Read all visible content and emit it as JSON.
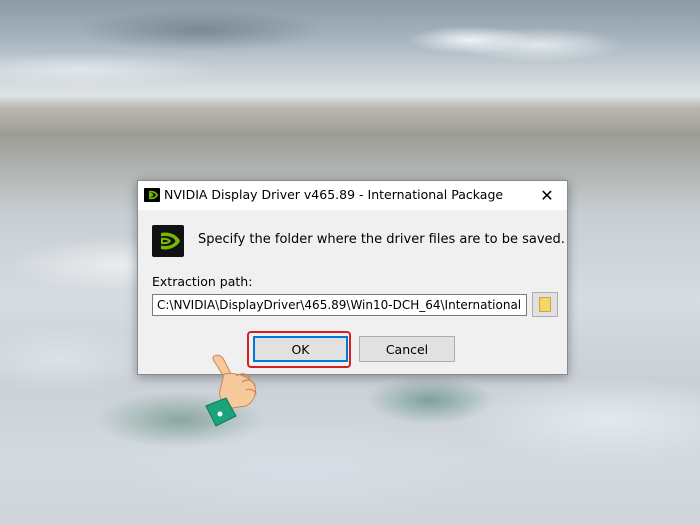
{
  "dialog": {
    "title": "NVIDIA Display Driver v465.89 - International Package",
    "close_glyph": "✕",
    "message": "Specify the folder where the driver files are to be saved.",
    "path_label": "Extraction path:",
    "path_value": "C:\\NVIDIA\\DisplayDriver\\465.89\\Win10-DCH_64\\International",
    "ok_label": "OK",
    "cancel_label": "Cancel",
    "app_icon": "nvidia-logo-icon",
    "browse_icon": "folder-icon"
  },
  "annotation": {
    "highlight_color": "#d42020",
    "pointer": "pointing-hand-icon"
  },
  "colors": {
    "nvidia_green": "#76b900",
    "dialog_bg": "#f0f0f0",
    "focus_border": "#0078d7"
  }
}
